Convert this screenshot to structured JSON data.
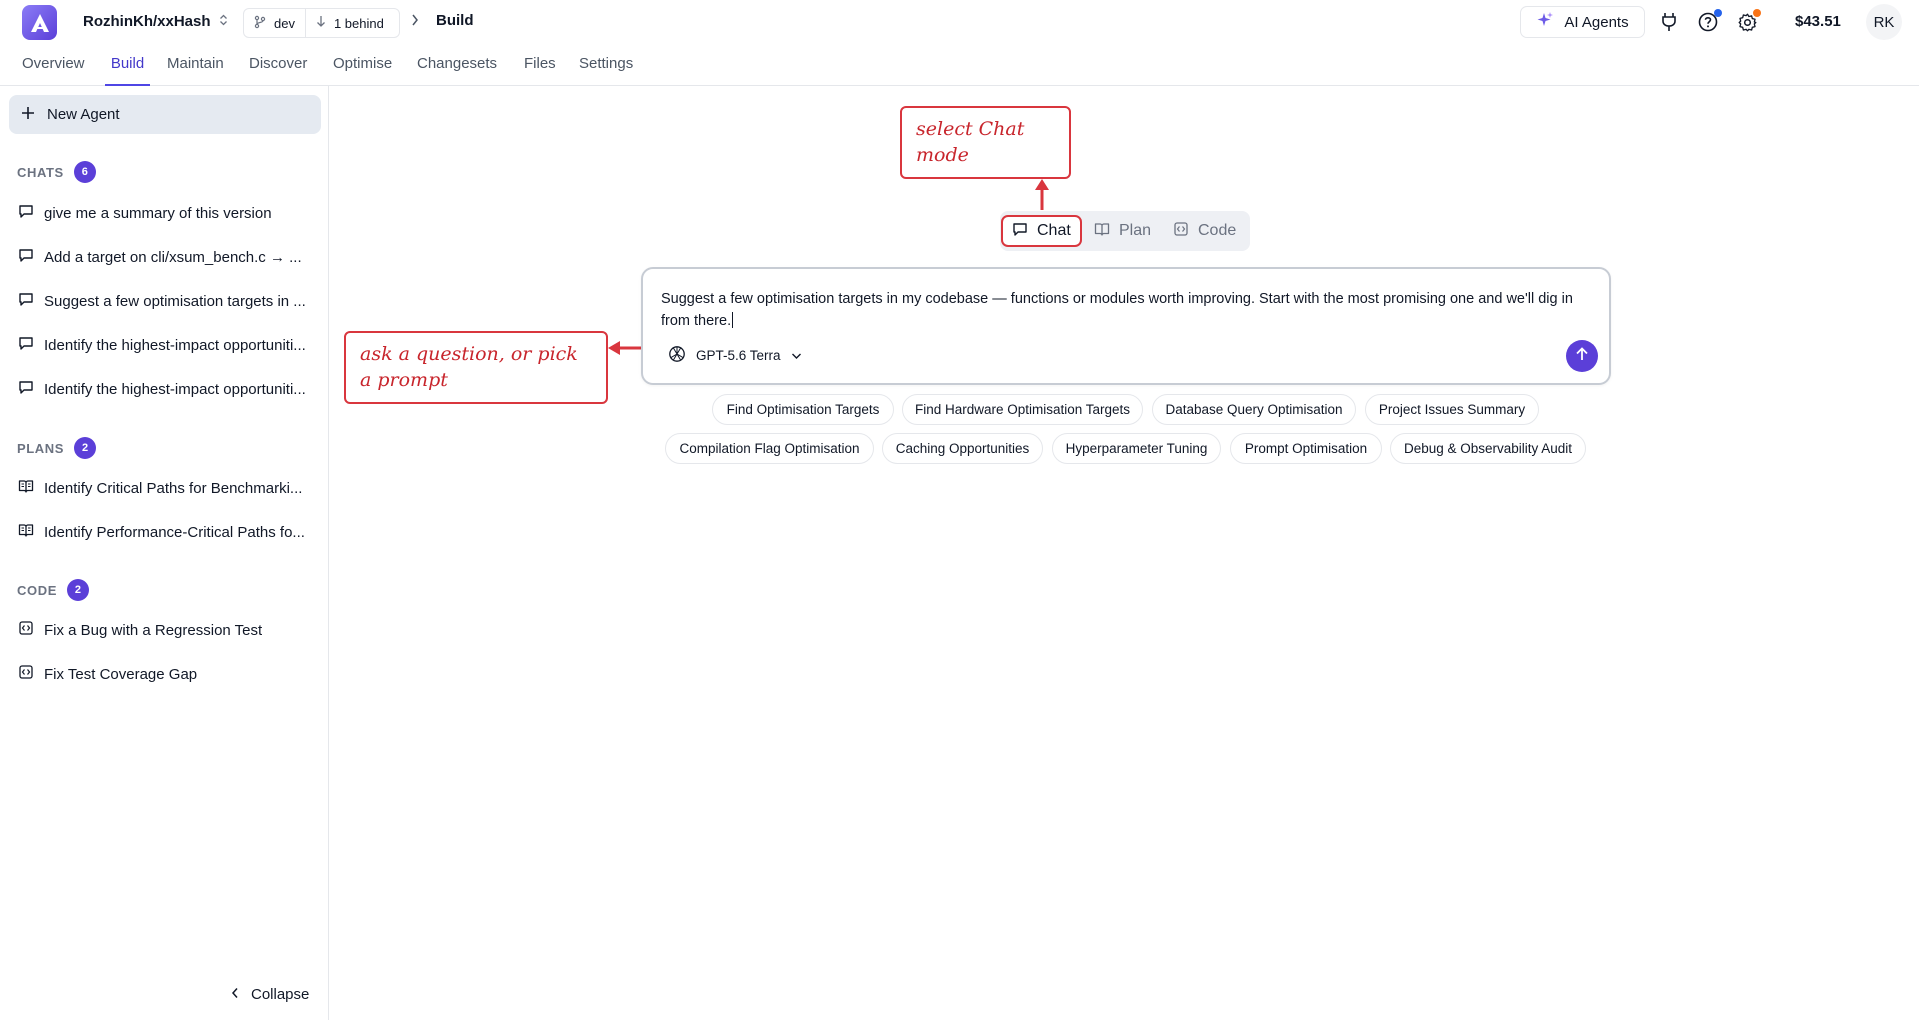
{
  "header": {
    "repo": "RozhinKh/xxHash",
    "branch": "dev",
    "behind": "1 behind",
    "current_page": "Build",
    "ai_agents_label": "AI Agents",
    "balance": "$43.51",
    "avatar_initials": "RK",
    "colors": {
      "brand": "#5b3fd8",
      "help_dot": "#2563eb",
      "settings_dot": "#f97316"
    }
  },
  "nav": {
    "tabs": [
      {
        "label": "Overview"
      },
      {
        "label": "Build"
      },
      {
        "label": "Maintain"
      },
      {
        "label": "Discover"
      },
      {
        "label": "Optimise"
      },
      {
        "label": "Changesets"
      },
      {
        "label": "Files"
      },
      {
        "label": "Settings"
      }
    ]
  },
  "sidebar": {
    "new_agent_label": "New Agent",
    "chats": {
      "heading": "CHATS",
      "count": "6",
      "items": [
        {
          "label": "give me a summary of this version"
        },
        {
          "label": "Add a target on cli/xsum_bench.c → ..."
        },
        {
          "label": "Suggest a few optimisation targets in ..."
        },
        {
          "label": "Identify the highest-impact opportuniti..."
        },
        {
          "label": "Identify the highest-impact opportuniti..."
        }
      ]
    },
    "plans": {
      "heading": "PLANS",
      "count": "2",
      "items": [
        {
          "label": "Identify Critical Paths for Benchmarki..."
        },
        {
          "label": "Identify Performance-Critical Paths fo..."
        }
      ]
    },
    "code": {
      "heading": "CODE",
      "count": "2",
      "items": [
        {
          "label": "Fix a Bug with a Regression Test"
        },
        {
          "label": "Fix Test Coverage Gap"
        }
      ]
    },
    "collapse_label": "Collapse"
  },
  "modes": {
    "selected": "Chat",
    "items": [
      {
        "label": "Chat"
      },
      {
        "label": "Plan"
      },
      {
        "label": "Code"
      }
    ]
  },
  "composer": {
    "value": "Suggest a few optimisation targets in my codebase — functions or modules worth improving. Start with the most promising one and we'll dig in from there.",
    "model": "GPT-5.6 Terra"
  },
  "prompts": [
    {
      "label": "Find Optimisation Targets"
    },
    {
      "label": "Find Hardware Optimisation Targets"
    },
    {
      "label": "Database Query Optimisation"
    },
    {
      "label": "Project Issues Summary"
    },
    {
      "label": "Compilation Flag Optimisation"
    },
    {
      "label": "Caching Opportunities"
    },
    {
      "label": "Hyperparameter Tuning"
    },
    {
      "label": "Prompt Optimisation"
    },
    {
      "label": "Debug & Observability Audit"
    }
  ],
  "annotations": {
    "mode_note": "select Chat mode",
    "prompt_note": "ask a question, or pick a prompt",
    "color": "#d9363e"
  }
}
